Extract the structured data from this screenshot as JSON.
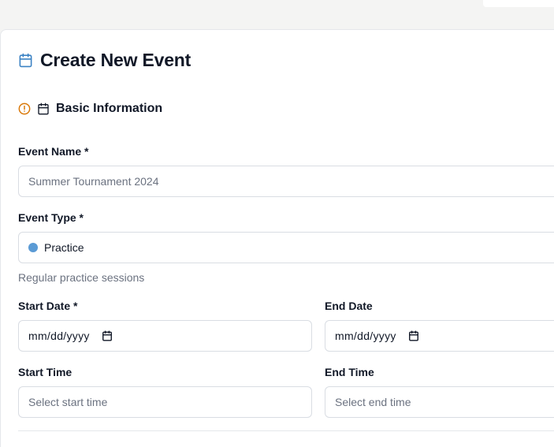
{
  "colors": {
    "accent_icon": "#3b82c4",
    "warning_icon": "#d97706",
    "event_type_dot": "#5b9bd5"
  },
  "page": {
    "title": "Create New Event",
    "title_icon": "calendar-icon"
  },
  "section": {
    "title": "Basic Information",
    "status_icon": "alert-circle-icon",
    "icon": "calendar-icon"
  },
  "form": {
    "event_name": {
      "label": "Event Name *",
      "placeholder": "Summer Tournament 2024",
      "value": ""
    },
    "event_type": {
      "label": "Event Type *",
      "value": "Practice",
      "helper": "Regular practice sessions"
    },
    "start_date": {
      "label": "Start Date *",
      "value": "mm/dd/yyyy"
    },
    "end_date": {
      "label": "End Date",
      "value": "mm/dd/yyyy"
    },
    "start_time": {
      "label": "Start Time",
      "placeholder": "Select start time"
    },
    "end_time": {
      "label": "End Time",
      "placeholder": "Select end time"
    }
  }
}
